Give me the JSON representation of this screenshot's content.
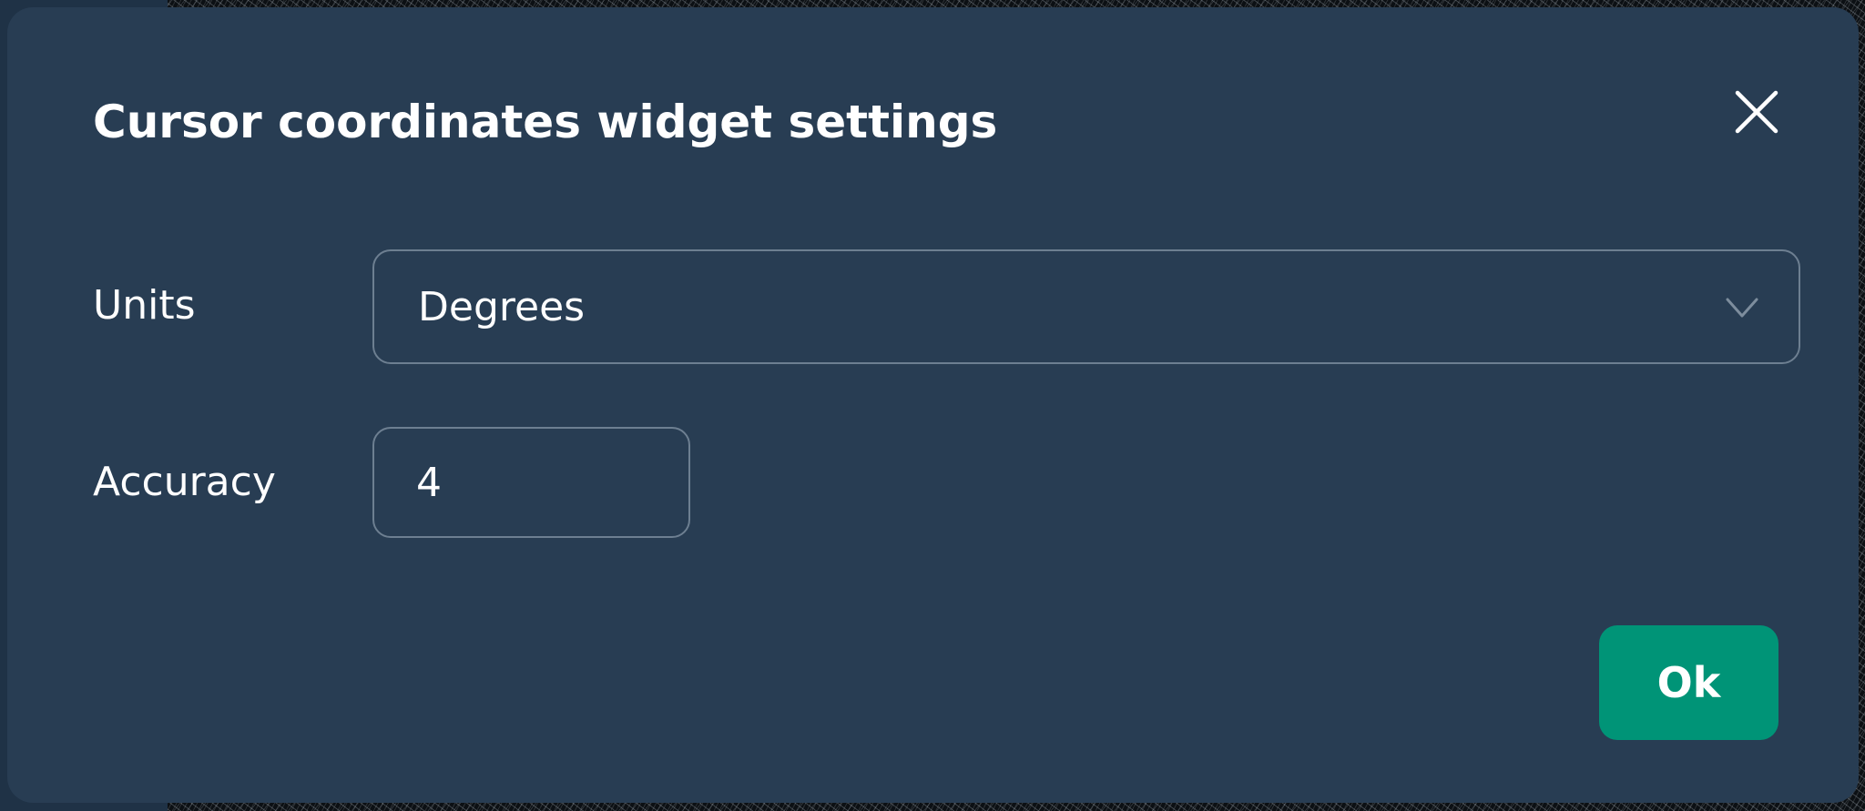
{
  "dialog": {
    "title": "Cursor coordinates widget settings",
    "close_icon": "close-icon"
  },
  "fields": {
    "units": {
      "label": "Units",
      "selected": "Degrees",
      "icon": "chevron-down-icon"
    },
    "accuracy": {
      "label": "Accuracy",
      "value": "4"
    }
  },
  "actions": {
    "ok_label": "Ok"
  },
  "colors": {
    "dialog_background": "#283d53",
    "field_border": "#6d7f91",
    "primary_button": "#009477",
    "text": "#ffffff"
  }
}
